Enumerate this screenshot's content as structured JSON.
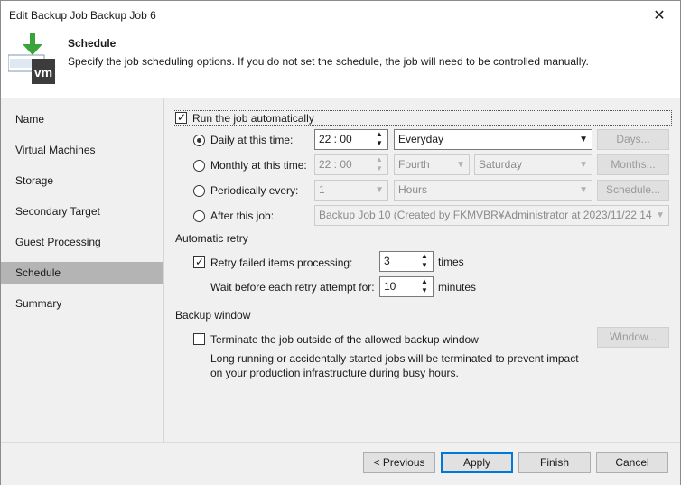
{
  "window": {
    "title": "Edit Backup Job Backup Job 6",
    "close_glyph": "✕"
  },
  "header": {
    "title": "Schedule",
    "description": "Specify the job scheduling options. If you do not set the schedule, the job will need to be controlled manually.",
    "icon": "vm-download-icon",
    "icon_text": "vm"
  },
  "sidebar": {
    "items": [
      {
        "label": "Name",
        "active": false
      },
      {
        "label": "Virtual Machines",
        "active": false
      },
      {
        "label": "Storage",
        "active": false
      },
      {
        "label": "Secondary Target",
        "active": false
      },
      {
        "label": "Guest Processing",
        "active": false
      },
      {
        "label": "Schedule",
        "active": true
      },
      {
        "label": "Summary",
        "active": false
      }
    ]
  },
  "schedule": {
    "run_auto": {
      "label": "Run the job automatically",
      "checked": true
    },
    "daily": {
      "label": "Daily at this time:",
      "selected": true,
      "time": "22 : 00",
      "day_option": "Everyday",
      "button": "Days..."
    },
    "monthly": {
      "label": "Monthly at this time:",
      "selected": false,
      "time": "22 : 00",
      "week": "Fourth",
      "day": "Saturday",
      "button": "Months..."
    },
    "periodically": {
      "label": "Periodically every:",
      "selected": false,
      "value": "1",
      "unit": "Hours",
      "button": "Schedule..."
    },
    "after_job": {
      "label": "After this job:",
      "selected": false,
      "value": "Backup Job 10 (Created by FKMVBR¥Administrator at 2023/11/22 14"
    }
  },
  "retry": {
    "section_title": "Automatic retry",
    "retry_failed": {
      "label": "Retry failed items processing:",
      "checked": true,
      "value": "3",
      "unit": "times"
    },
    "wait": {
      "label": "Wait before each retry attempt for:",
      "value": "10",
      "unit": "minutes"
    }
  },
  "backup_window": {
    "section_title": "Backup window",
    "terminate": {
      "label": "Terminate the job outside of the allowed backup window",
      "checked": false
    },
    "note_line1": "Long running or accidentally started jobs will be terminated to prevent impact",
    "note_line2": "on your production infrastructure during busy hours.",
    "button": "Window..."
  },
  "footer": {
    "previous": "< Previous",
    "apply": "Apply",
    "finish": "Finish",
    "cancel": "Cancel"
  },
  "colors": {
    "accent": "#0078d7",
    "icon_green": "#3aa33a",
    "icon_dark": "#3c3c3c"
  }
}
